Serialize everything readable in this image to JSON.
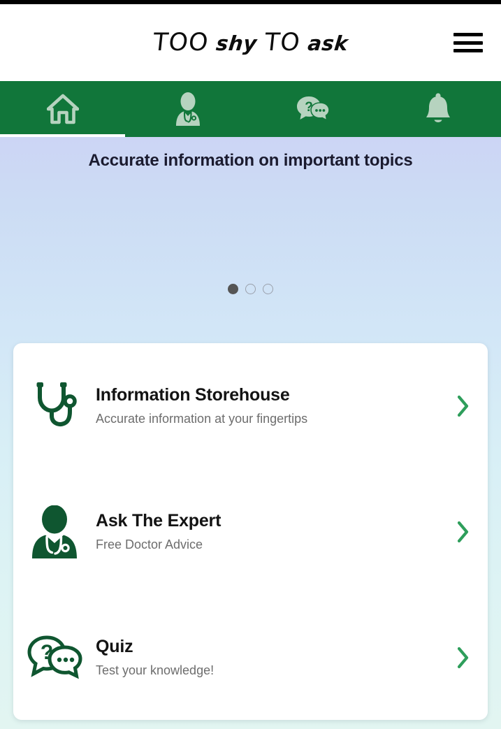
{
  "app": {
    "brand": {
      "word1": "TOO",
      "word2": "shy",
      "word3": "TO",
      "word4": "ask",
      "full": "TOO shy TO ask"
    },
    "colors": {
      "nav_green": "#11763a",
      "icon_dark_green": "#0f5630",
      "chevron_green": "#2e9e5b",
      "nav_icon": "#b6d3bf",
      "bg_top": "#c9caf6",
      "bg_bottom": "#e2f5f1",
      "card_bg": "#ffffff",
      "title_color": "#1b1b2f"
    }
  },
  "header": {
    "menu_label": "menu"
  },
  "navbar": {
    "tabs": [
      {
        "name": "home",
        "icon": "home-icon",
        "active": true
      },
      {
        "name": "doctor",
        "icon": "doctor-icon",
        "active": false
      },
      {
        "name": "quiz",
        "icon": "quiz-chat-icon",
        "active": false
      },
      {
        "name": "notifications",
        "icon": "bell-icon",
        "active": false
      }
    ]
  },
  "hero": {
    "title": "Accurate information on important topics",
    "carousel": {
      "total": 3,
      "active_index": 0
    }
  },
  "menu": {
    "items": [
      {
        "icon": "stethoscope-icon",
        "title": "Information Storehouse",
        "subtitle": "Accurate information at your fingertips",
        "chevron": "chevron-right-icon"
      },
      {
        "icon": "doctor-bust-icon",
        "title": "Ask The Expert",
        "subtitle": "Free Doctor Advice",
        "chevron": "chevron-right-icon"
      },
      {
        "icon": "quiz-chat-icon",
        "title": "Quiz",
        "subtitle": "Test your knowledge!",
        "chevron": "chevron-right-icon"
      }
    ]
  }
}
